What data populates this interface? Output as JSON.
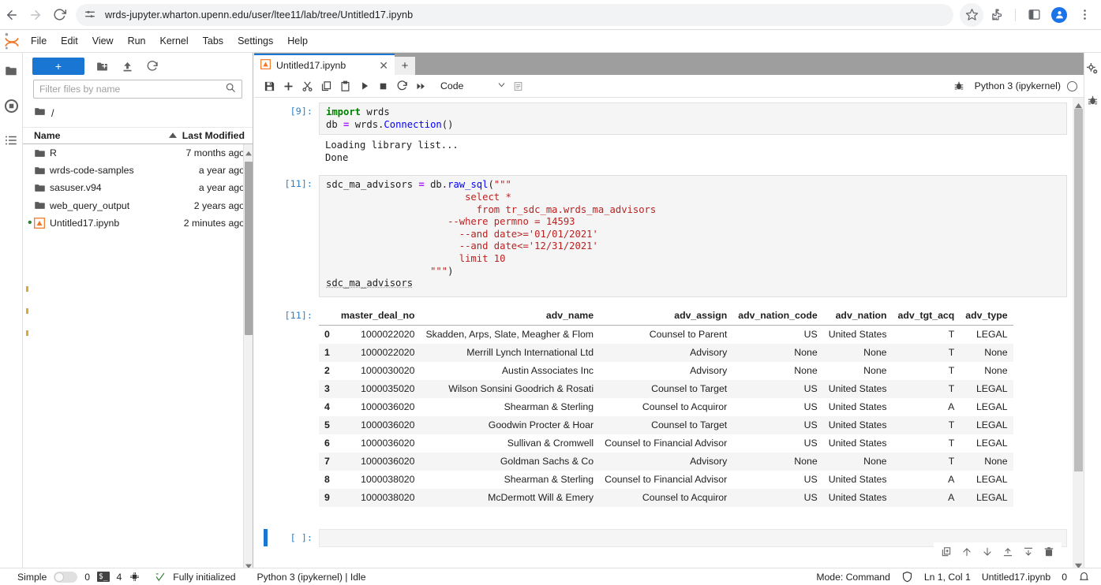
{
  "browser": {
    "url": "wrds-jupyter.wharton.upenn.edu/user/ltee11/lab/tree/Untitled17.ipynb",
    "back_icon": "back-arrow-icon",
    "forward_icon": "forward-arrow-icon",
    "reload_icon": "reload-icon",
    "site_settings_icon": "site-settings-icon",
    "bookmark_icon": "star-icon",
    "extensions_icon": "puzzle-icon",
    "sidepanel_icon": "side-panel-icon",
    "profile_icon": "profile-avatar-icon",
    "menu_icon": "three-dot-menu-icon"
  },
  "menubar": {
    "items": [
      {
        "label": "File"
      },
      {
        "label": "Edit"
      },
      {
        "label": "View"
      },
      {
        "label": "Run"
      },
      {
        "label": "Kernel"
      },
      {
        "label": "Tabs"
      },
      {
        "label": "Settings"
      },
      {
        "label": "Help"
      }
    ]
  },
  "activity_bar": {
    "items": [
      {
        "name": "file-browser-icon"
      },
      {
        "name": "running-terminals-icon"
      },
      {
        "name": "table-of-contents-icon"
      }
    ]
  },
  "file_browser": {
    "new_launcher_label": "+",
    "new_folder_icon": "new-folder-icon",
    "upload_icon": "upload-icon",
    "refresh_icon": "refresh-icon",
    "filter": {
      "placeholder": "Filter files by name",
      "value": "",
      "search_icon": "search-icon"
    },
    "breadcrumb": "/",
    "columns": {
      "name": "Name",
      "last_modified": "Last Modified",
      "sort_icon": "sort-ascending-icon"
    },
    "rows": [
      {
        "name": "R",
        "modified": "7 months ago",
        "type": "folder",
        "dirty": false
      },
      {
        "name": "wrds-code-samples",
        "modified": "a year ago",
        "type": "folder",
        "dirty": false
      },
      {
        "name": "sasuser.v94",
        "modified": "a year ago",
        "type": "folder",
        "dirty": false
      },
      {
        "name": "web_query_output",
        "modified": "2 years ago",
        "type": "folder",
        "dirty": false
      },
      {
        "name": "Untitled17.ipynb",
        "modified": "2 minutes ago",
        "type": "notebook",
        "dirty": true
      }
    ]
  },
  "notebook": {
    "tab_label": "Untitled17.ipynb",
    "tab_close_icon": "close-icon",
    "add_tab_label": "+",
    "toolbar": {
      "save_icon": "save-icon",
      "insert_icon": "add-cell-icon",
      "cut_icon": "cut-icon",
      "copy_icon": "copy-icon",
      "paste_icon": "paste-icon",
      "run_icon": "run-icon",
      "stop_icon": "stop-icon",
      "restart_icon": "restart-icon",
      "restart_run_all_icon": "restart-run-all-icon",
      "cell_type": "Code",
      "cell_type_chevron": "chevron-down-icon",
      "panel_icon": "notebook-panel-icon",
      "debugger_icon": "debugger-bug-icon",
      "kernel_name": "Python 3 (ipykernel)",
      "kernel_status_icon": "kernel-idle-circle-icon"
    },
    "cells": [
      {
        "prompt": "[9]:",
        "source_lines": [
          [
            {
              "t": "import",
              "c": "k"
            },
            {
              "t": " wrds",
              "c": "var"
            }
          ],
          [
            {
              "t": "db ",
              "c": "var"
            },
            {
              "t": "=",
              "c": "op"
            },
            {
              "t": " wrds.",
              "c": "var"
            },
            {
              "t": "Connection",
              "c": "fn"
            },
            {
              "t": "()",
              "c": "var"
            }
          ]
        ],
        "output_text": "Loading library list...\nDone"
      },
      {
        "prompt": "[11]:",
        "source_lines": [
          [
            {
              "t": "sdc_ma_advisors ",
              "c": "var"
            },
            {
              "t": "=",
              "c": "op"
            },
            {
              "t": " db.",
              "c": "var"
            },
            {
              "t": "raw_sql",
              "c": "fn"
            },
            {
              "t": "(",
              "c": "var"
            },
            {
              "t": "\"\"\"",
              "c": "str"
            }
          ],
          [
            {
              "t": "                        select *",
              "c": "str"
            }
          ],
          [
            {
              "t": "                          from tr_sdc_ma.wrds_ma_advisors",
              "c": "str"
            }
          ],
          [
            {
              "t": "                     --where permno = 14593",
              "c": "str"
            }
          ],
          [
            {
              "t": "                       --and date>='01/01/2021'",
              "c": "str"
            }
          ],
          [
            {
              "t": "                       --and date<='12/31/2021'",
              "c": "str"
            }
          ],
          [
            {
              "t": "                       limit 10",
              "c": "str"
            }
          ],
          [
            {
              "t": "                  \"\"\"",
              "c": "str"
            },
            {
              "t": ")",
              "c": "var"
            }
          ],
          [
            {
              "t": "sdc_ma_advisors",
              "c": "undl"
            }
          ]
        ],
        "output_prompt": "[11]:"
      },
      {
        "prompt": "[ ]:",
        "source_lines": [],
        "active": true
      }
    ],
    "dataframe": {
      "columns": [
        "",
        "master_deal_no",
        "adv_name",
        "adv_assign",
        "adv_nation_code",
        "adv_nation",
        "adv_tgt_acq",
        "adv_type"
      ],
      "rows": [
        [
          "0",
          "1000022020",
          "Skadden, Arps, Slate, Meagher & Flom",
          "Counsel to Parent",
          "US",
          "United States",
          "T",
          "LEGAL"
        ],
        [
          "1",
          "1000022020",
          "Merrill Lynch International Ltd",
          "Advisory",
          "None",
          "None",
          "T",
          "None"
        ],
        [
          "2",
          "1000030020",
          "Austin Associates Inc",
          "Advisory",
          "None",
          "None",
          "T",
          "None"
        ],
        [
          "3",
          "1000035020",
          "Wilson Sonsini Goodrich & Rosati",
          "Counsel to Target",
          "US",
          "United States",
          "T",
          "LEGAL"
        ],
        [
          "4",
          "1000036020",
          "Shearman & Sterling",
          "Counsel to Acquiror",
          "US",
          "United States",
          "A",
          "LEGAL"
        ],
        [
          "5",
          "1000036020",
          "Goodwin Procter & Hoar",
          "Counsel to Target",
          "US",
          "United States",
          "T",
          "LEGAL"
        ],
        [
          "6",
          "1000036020",
          "Sullivan & Cromwell",
          "Counsel to Financial Advisor",
          "US",
          "United States",
          "T",
          "LEGAL"
        ],
        [
          "7",
          "1000036020",
          "Goldman Sachs & Co",
          "Advisory",
          "None",
          "None",
          "T",
          "None"
        ],
        [
          "8",
          "1000038020",
          "Shearman & Sterling",
          "Counsel to Financial Advisor",
          "US",
          "United States",
          "A",
          "LEGAL"
        ],
        [
          "9",
          "1000038020",
          "McDermott Will & Emery",
          "Counsel to Acquiror",
          "US",
          "United States",
          "A",
          "LEGAL"
        ]
      ]
    },
    "cell_actions": [
      {
        "name": "duplicate-cell-icon"
      },
      {
        "name": "move-cell-up-icon"
      },
      {
        "name": "move-cell-down-icon"
      },
      {
        "name": "insert-cell-above-icon"
      },
      {
        "name": "insert-cell-below-icon"
      },
      {
        "name": "delete-cell-icon"
      }
    ]
  },
  "right_sidebar": {
    "items": [
      {
        "name": "property-inspector-icon"
      },
      {
        "name": "debugger-icon"
      }
    ]
  },
  "status_bar": {
    "simple_label": "Simple",
    "simple_toggle_on": false,
    "terminals_count": "0",
    "terminal_icon": "terminal-icon",
    "kernels_count": "4",
    "kernel_icon": "kernel-chip-icon",
    "init_icon": "initialized-icon",
    "init_label": "Fully initialized",
    "kernel_status": "Python 3 (ipykernel) | Idle",
    "mode": "Mode: Command",
    "shield_icon": "trusted-shield-icon",
    "cursor_position": "Ln 1, Col 1",
    "file_name": "Untitled17.ipynb",
    "notification_count": "0",
    "bell_icon": "bell-icon"
  },
  "colors": {
    "accent_blue": "#1976d2",
    "chrome_blue": "#1a73e8",
    "prompt_blue": "#307fc1",
    "string_red": "#ba2121",
    "keyword_green": "#008000",
    "dirty_yellow": "#d5ab3a"
  }
}
